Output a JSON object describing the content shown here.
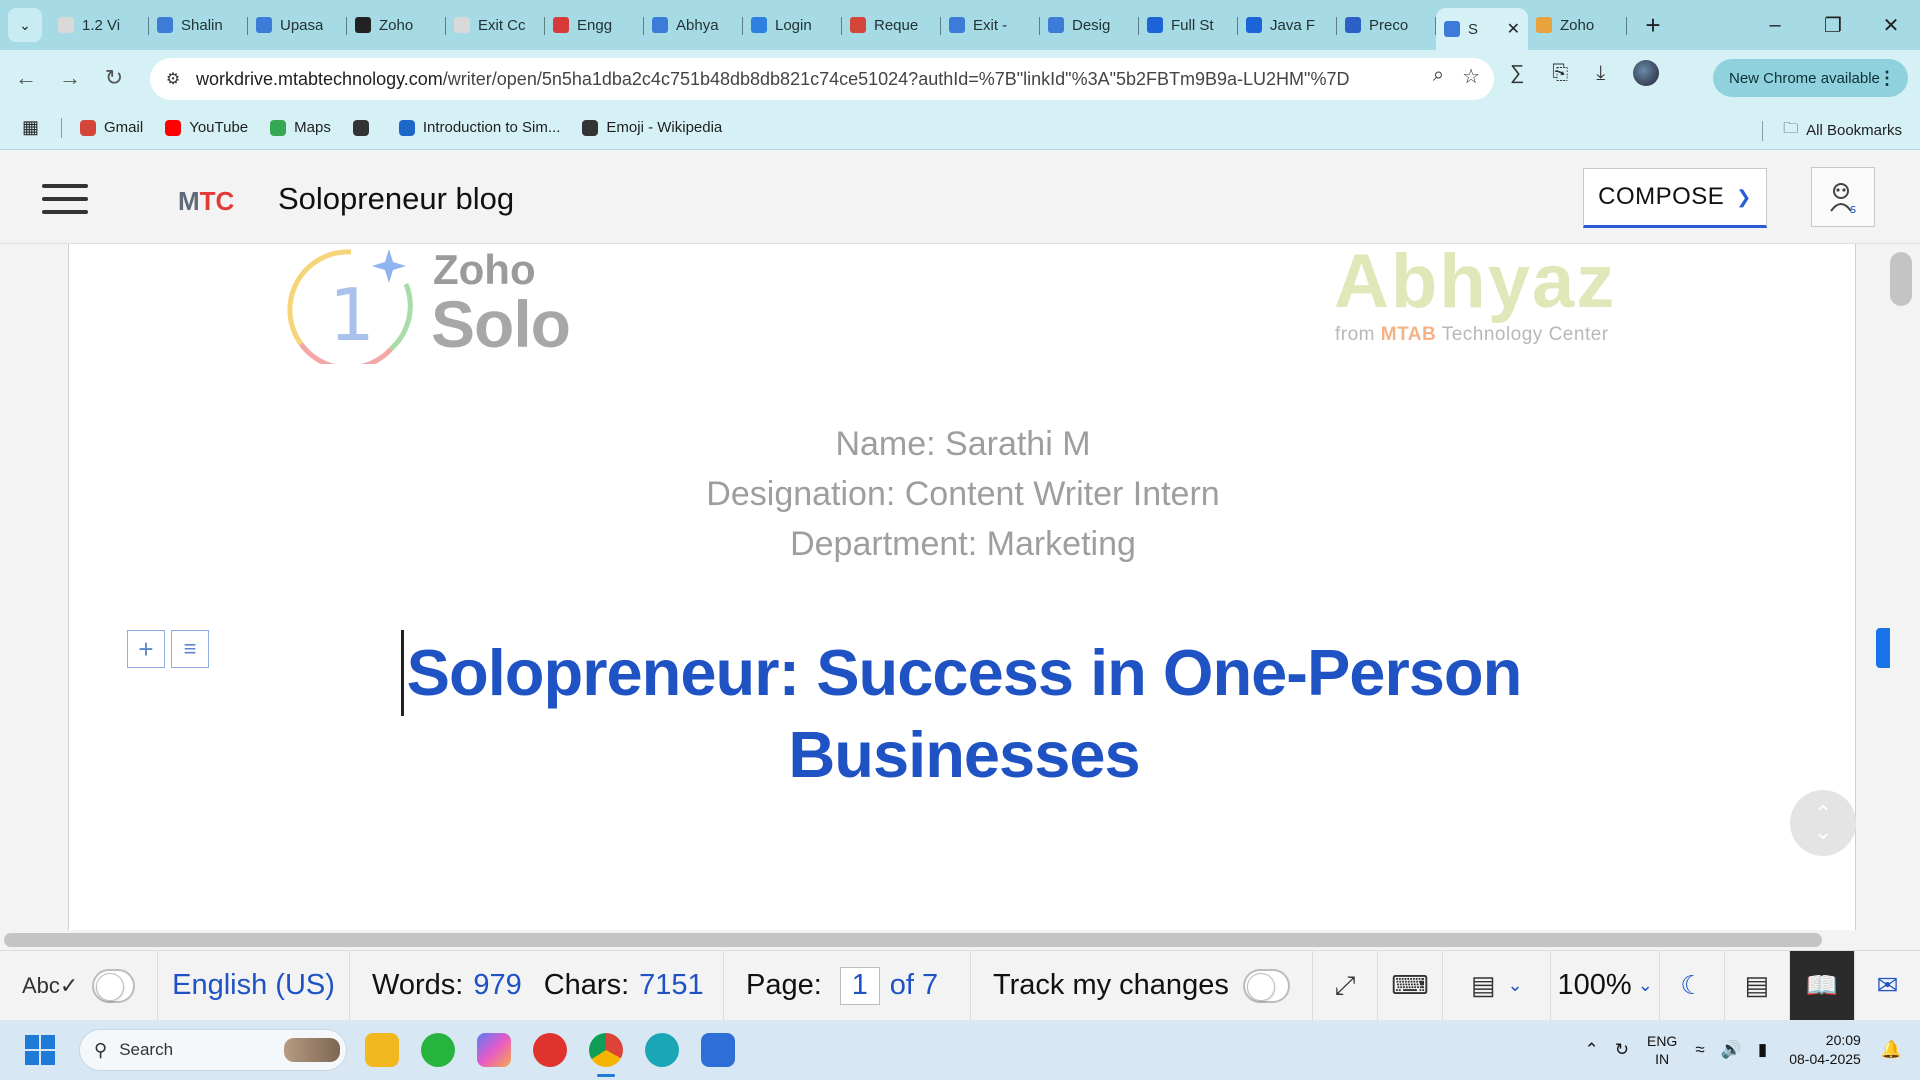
{
  "browser": {
    "tabs": [
      {
        "label": "1.2 Vi",
        "color": "#d9d9d9"
      },
      {
        "label": "Shalin",
        "color": "#3d7bd9"
      },
      {
        "label": "Upasa",
        "color": "#3d7bd9"
      },
      {
        "label": "Zoho",
        "color": "#222222"
      },
      {
        "label": "Exit Cc",
        "color": "#d9d9d9"
      },
      {
        "label": "Engg",
        "color": "#d63a3a"
      },
      {
        "label": "Abhya",
        "color": "#3d7bd9"
      },
      {
        "label": "Login",
        "color": "#2d7fe0"
      },
      {
        "label": "Reque",
        "color": "#d44638"
      },
      {
        "label": "Exit -",
        "color": "#3d7bd9"
      },
      {
        "label": "Desig",
        "color": "#3d7bd9"
      },
      {
        "label": "Full St",
        "color": "#1b63d6"
      },
      {
        "label": "Java F",
        "color": "#1b63d6"
      },
      {
        "label": "Preco",
        "color": "#2c5fc8"
      },
      {
        "label": "S",
        "color": "#3d7bd9"
      },
      {
        "label": "Zoho",
        "color": "#e8a33d"
      }
    ],
    "url_host": "workdrive.mtabtechnology.com",
    "url_path": "/writer/open/5n5ha1dba2c4c751b48db8db821c74ce51024?authId=%7B\"linkId\"%3A\"5b2FBTm9B9a-LU2HM\"%7D",
    "new_chrome": "New Chrome available",
    "bookmarks": [
      {
        "label": "Gmail",
        "color": "#d44638"
      },
      {
        "label": "YouTube",
        "color": "#ff0000"
      },
      {
        "label": "Maps",
        "color": "#34a853"
      },
      {
        "label": "",
        "color": "#333333"
      },
      {
        "label": "Introduction to Sim...",
        "color": "#1e66c9"
      },
      {
        "label": "Emoji - Wikipedia",
        "color": "#333333"
      }
    ],
    "all_bookmarks": "All Bookmarks"
  },
  "app": {
    "brand_m": "M",
    "brand_tc": "TC",
    "title": "Solopreneur blog",
    "compose_label": "COMPOSE"
  },
  "document": {
    "logo_zoho": "Zoho",
    "logo_solo": "Solo",
    "logo_one": "1",
    "logo_abhyaz": "Abhyaz",
    "logo_abhyaz_from": "from",
    "logo_abhyaz_mtab": "MTAB",
    "logo_abhyaz_center": "Technology Center",
    "name_line": "Name: Sarathi  M",
    "designation_line": "Designation: Content Writer Intern",
    "department_line": "Department: Marketing",
    "heading_line1": "Solopreneur: Success in One-Person",
    "heading_line2": "Businesses"
  },
  "statusbar": {
    "language": "English (US)",
    "words_label": "Words:",
    "words_value": "979",
    "chars_label": "Chars:",
    "chars_value": "7151",
    "page_label": "Page:",
    "page_value": "1",
    "page_of": "of 7",
    "track_label": "Track my changes",
    "zoom": "100%"
  },
  "taskbar": {
    "search_placeholder": "Search",
    "lang_top": "ENG",
    "lang_bottom": "IN",
    "time": "20:09",
    "date": "08-04-2025"
  },
  "colors": {
    "accent": "#1f53c4",
    "tabstrip": "#a6dbe6",
    "toolbar": "#d6f1f5",
    "brand_red": "#e53935"
  }
}
